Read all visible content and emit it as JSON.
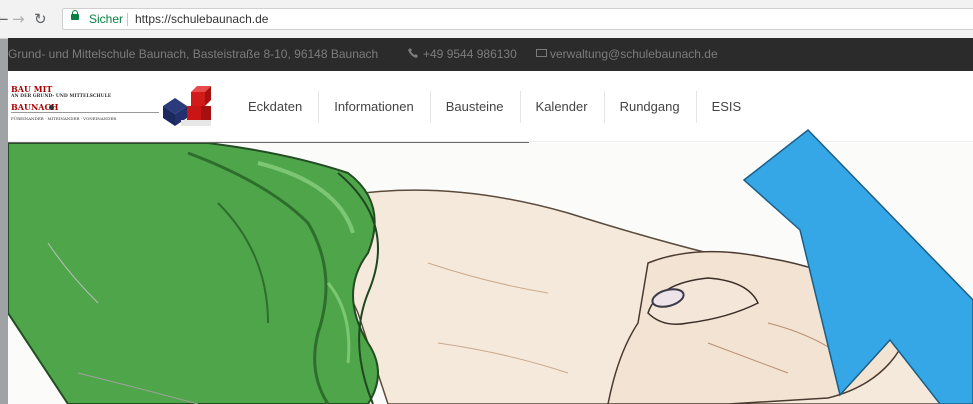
{
  "browser": {
    "back_icon": "arrow-left-icon",
    "forward_icon": "arrow-right-icon",
    "reload_icon": "reload-icon",
    "secure_label": "Sicher",
    "url": "https://schulebaunach.de"
  },
  "topbar": {
    "address": "Grund- und Mittelschule Baunach, Basteistraße 8-10, 96148 Baunach",
    "phone": "+49 9544 986130",
    "email": "verwaltung@schulebaunach.de"
  },
  "logo": {
    "line1": "BAU MIT",
    "line2": "AN DER GRUND- UND MITTELSCHULE",
    "line3": "BAUNACH",
    "line4": "FÜREINANDER  ·  MITEINANDER  ·  VONEINANDER"
  },
  "nav": {
    "items": [
      "Eckdaten",
      "Informationen",
      "Bausteine",
      "Kalender",
      "Rundgang",
      "ESIS"
    ]
  },
  "colors": {
    "topbar_bg": "#2b2b2b",
    "arrow_fill": "#35a7e6",
    "secure_green": "#0b8043"
  }
}
